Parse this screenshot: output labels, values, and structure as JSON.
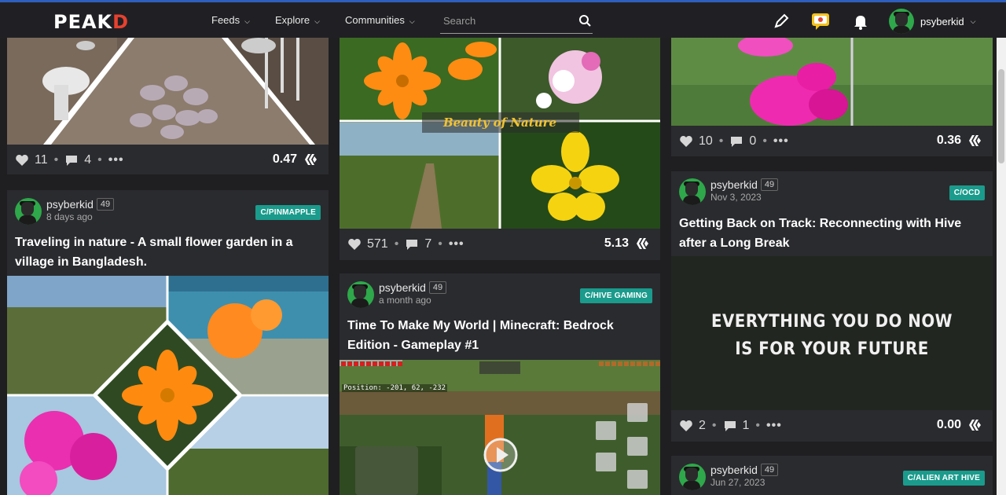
{
  "nav": {
    "logo_main": "PEAK",
    "logo_accent": "D",
    "items": [
      {
        "label": "Feeds"
      },
      {
        "label": "Explore"
      },
      {
        "label": "Communities"
      }
    ],
    "search_placeholder": "Search",
    "username": "psyberkid"
  },
  "posts": {
    "col1_top": {
      "votes": "11",
      "comments": "4",
      "payout": "0.47"
    },
    "col2_top": {
      "overlay_text": "Beauty of Nature",
      "votes": "571",
      "comments": "7",
      "payout": "5.13"
    },
    "col3_top": {
      "votes": "10",
      "comments": "0",
      "payout": "0.36"
    },
    "col1_second": {
      "author": "psyberkid",
      "rep": "49",
      "time": "8 days ago",
      "community": "C/PINMAPPLE",
      "title": "Traveling in nature - A small flower garden in a village in Bangladesh."
    },
    "col2_second": {
      "author": "psyberkid",
      "rep": "49",
      "time": "a month ago",
      "community": "C/HIVE GAMING",
      "title": "Time To Make My World | Minecraft: Bedrock Edition - Gameplay #1",
      "hud_text": "Position: -201, 62, -232"
    },
    "col3_second": {
      "author": "psyberkid",
      "rep": "49",
      "time": "Nov 3, 2023",
      "community": "C/OCD",
      "title": "Getting Back on Track: Reconnecting with Hive after a Long Break",
      "image_line1": "EVERYTHING YOU DO NOW",
      "image_line2": "IS FOR YOUR FUTURE",
      "votes": "2",
      "comments": "1",
      "payout": "0.00"
    },
    "col3_third": {
      "author": "psyberkid",
      "rep": "49",
      "time": "Jun 27, 2023",
      "community": "C/ALIEN ART HIVE"
    }
  },
  "colors": {
    "accent": "#e6412f",
    "badge": "#1a9b8c",
    "bg": "#1f1f22",
    "card": "#2a2b2f"
  }
}
